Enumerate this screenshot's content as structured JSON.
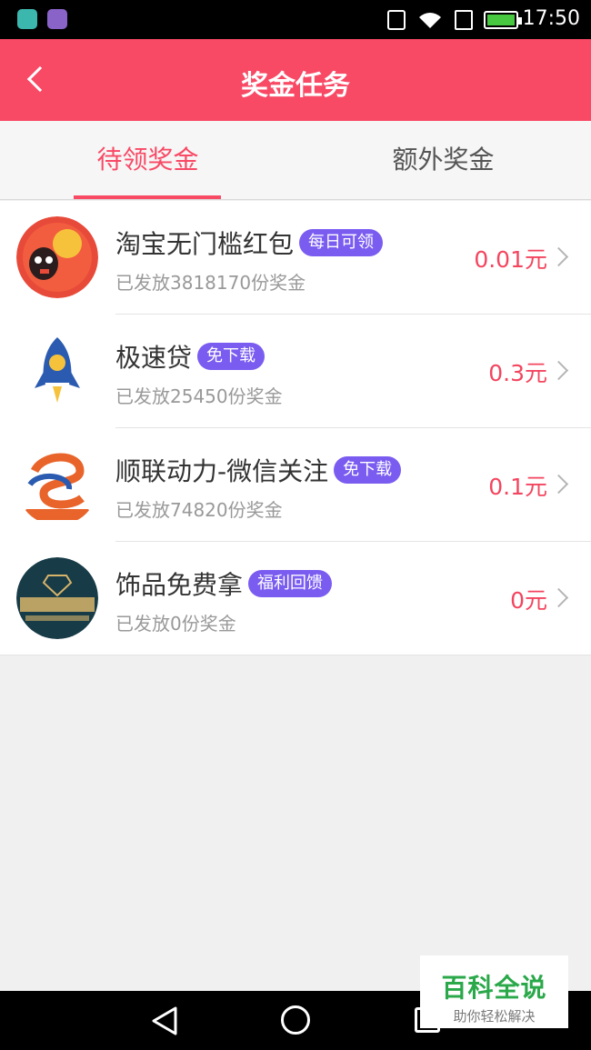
{
  "status_bar": {
    "time": "17:50",
    "icons": [
      "android-app-icon",
      "gallery-app-icon",
      "vibrate-icon",
      "wifi-icon",
      "sim-icon",
      "battery-charging-icon"
    ],
    "battery_color": "#48c840"
  },
  "header": {
    "back_icon": "chevron-left-icon",
    "title": "奖金任务",
    "background": "#f84965"
  },
  "tabs": [
    {
      "label": "待领奖金",
      "active": true
    },
    {
      "label": "额外奖金",
      "active": false
    }
  ],
  "tasks": [
    {
      "logo_icon": "taobao-redpacket-logo-icon",
      "name": "淘宝无门槛红包",
      "badge": "每日可领",
      "issued": "已发放3818170份奖金",
      "amount": "0.01元"
    },
    {
      "logo_icon": "rocket-logo-icon",
      "name": "极速贷",
      "badge": "免下载",
      "issued": "已发放25450份奖金",
      "amount": "0.3元"
    },
    {
      "logo_icon": "shunlian-logo-icon",
      "name": "顺联动力-微信关注",
      "badge": "免下载",
      "issued": "已发放74820份奖金",
      "amount": "0.1元"
    },
    {
      "logo_icon": "jewelry-logo-icon",
      "name": "饰品免费拿",
      "badge": "福利回馈",
      "issued": "已发放0份奖金",
      "amount": "0元"
    }
  ],
  "colors": {
    "accent": "#f84965",
    "badge": "#7a5cf0",
    "amount": "#f3455f"
  },
  "watermark": {
    "title": "百科全说",
    "subtitle": "助你轻松解决"
  },
  "nav_bar": {
    "buttons": [
      "back-triangle-icon",
      "home-circle-icon",
      "recents-square-icon"
    ]
  }
}
